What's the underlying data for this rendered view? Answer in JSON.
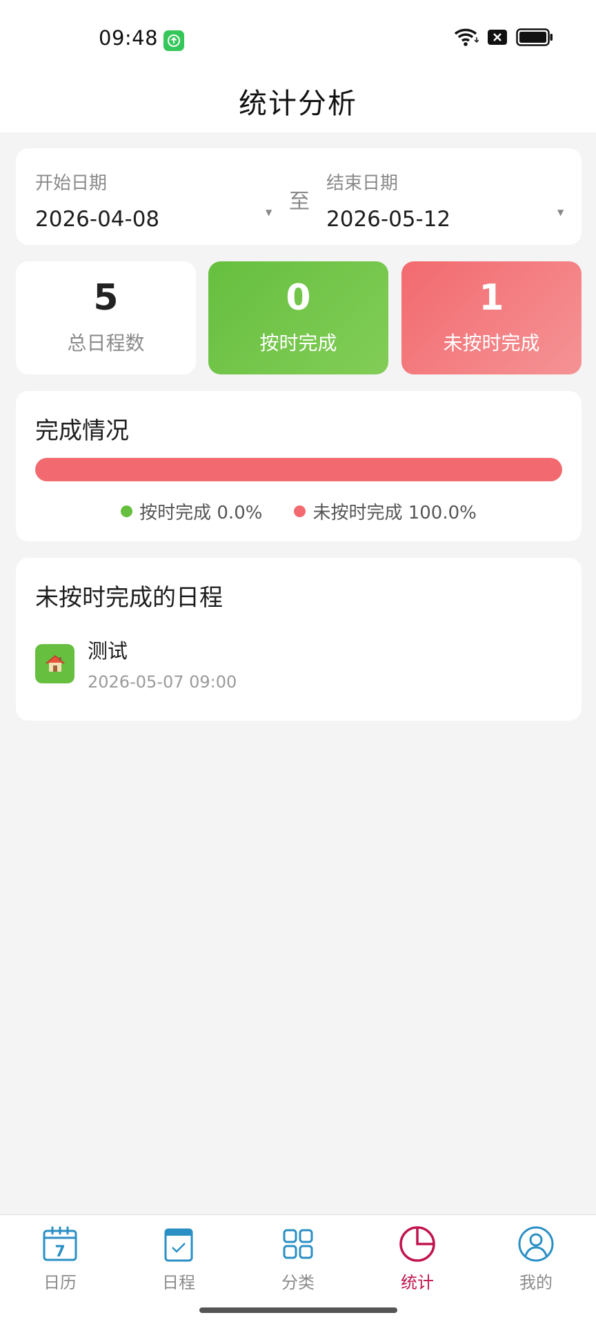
{
  "status_bar": {
    "time": "09:48"
  },
  "header": {
    "title": "统计分析"
  },
  "date_range": {
    "start_label": "开始日期",
    "start_value": "2026-04-08",
    "separator": "至",
    "end_label": "结束日期",
    "end_value": "2026-05-12"
  },
  "summary": {
    "total": {
      "value": "5",
      "label": "总日程数"
    },
    "on_time": {
      "value": "0",
      "label": "按时完成"
    },
    "late": {
      "value": "1",
      "label": "未按时完成"
    }
  },
  "completion": {
    "title": "完成情况",
    "on_time_fraction": 0.0,
    "legend_on_time": "按时完成 0.0%",
    "legend_late": "未按时完成 100.0%"
  },
  "late_list": {
    "title": "未按时完成的日程",
    "items": [
      {
        "title": "测试",
        "time": "2026-05-07 09:00",
        "icon": "house-icon"
      }
    ]
  },
  "nav": {
    "items": [
      {
        "label": "日历",
        "icon": "calendar-icon"
      },
      {
        "label": "日程",
        "icon": "clipboard-icon"
      },
      {
        "label": "分类",
        "icon": "grid-icon"
      },
      {
        "label": "统计",
        "icon": "pie-chart-icon"
      },
      {
        "label": "我的",
        "icon": "user-icon"
      }
    ],
    "active_index": 3
  },
  "colors": {
    "green": "#66bf3f",
    "red": "#f26a6f",
    "accent_active": "#c0144f",
    "nav_icon": "#2a8fc4"
  }
}
